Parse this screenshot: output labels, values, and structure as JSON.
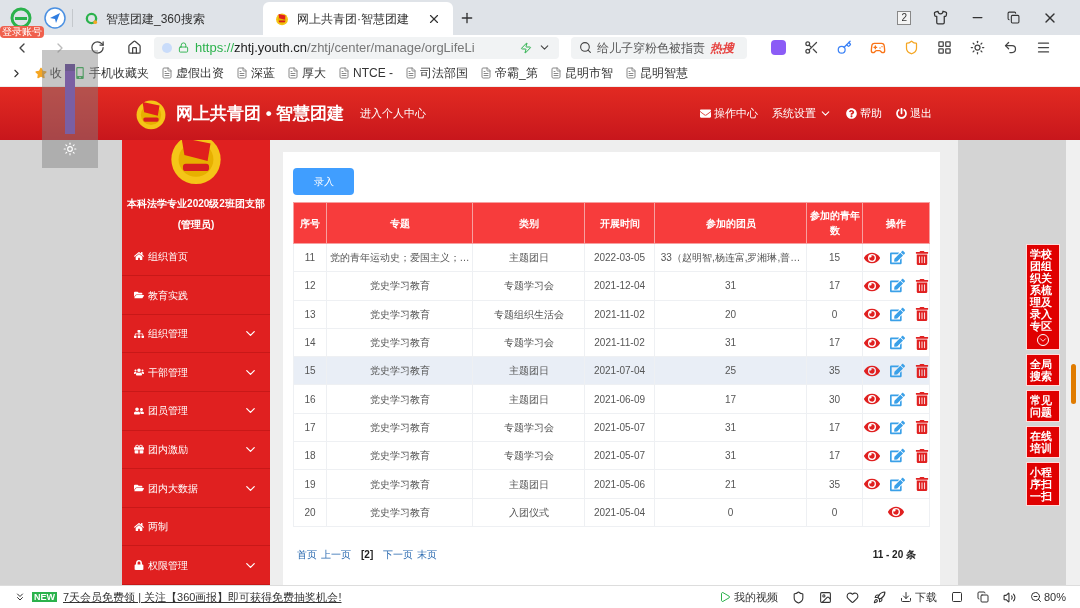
{
  "browser": {
    "login_badge": "登录账号",
    "tabs": [
      {
        "label": "智慧团建_360搜索",
        "selected": false
      },
      {
        "label": "网上共青团·智慧团建",
        "selected": true
      }
    ],
    "tab_count": "2",
    "url": {
      "scheme": "https://",
      "host": "zhtj.youth.cn",
      "path": "/zhtj/center/manage/orgLifeLi"
    },
    "search": {
      "value": "给儿子穿粉色被指责",
      "hot": "热搜"
    },
    "bookmarks": [
      "收",
      "手机收藏夹",
      "虚假出资",
      "深蓝",
      "厚大",
      "NTCE -",
      "司法部国",
      "帝霸_第",
      "昆明市智",
      "昆明智慧"
    ],
    "brightness": {
      "level": 0.9
    }
  },
  "header": {
    "title": "网上共青团 • 智慧团建",
    "personal": "进入个人中心",
    "links": [
      "操作中心",
      "系统设置",
      "帮助",
      "退出"
    ]
  },
  "sidebar": {
    "org_name": "本科法学专业2020级2班团支部",
    "role": "(管理员)",
    "items": [
      {
        "label": "组织首页",
        "expandable": false
      },
      {
        "label": "教育实践",
        "expandable": false
      },
      {
        "label": "组织管理",
        "expandable": true
      },
      {
        "label": "干部管理",
        "expandable": true
      },
      {
        "label": "团员管理",
        "expandable": true
      },
      {
        "label": "团内激励",
        "expandable": true
      },
      {
        "label": "团内大数据",
        "expandable": true
      },
      {
        "label": "两制",
        "expandable": false
      },
      {
        "label": "权限管理",
        "expandable": true
      }
    ]
  },
  "add_button": "录入",
  "table": {
    "columns": [
      "序号",
      "专题",
      "类别",
      "开展时间",
      "参加的团员",
      "参加的青年数",
      "操作"
    ],
    "rows": [
      {
        "cells": [
          "11",
          "党的青年运动史；爱国主义；…",
          "主题团日",
          "2022-03-05",
          "33（赵明智,杨连富,罗湘琳,普…",
          "15"
        ],
        "selected": false,
        "editable": true
      },
      {
        "cells": [
          "12",
          "党史学习教育",
          "专题学习会",
          "2021-12-04",
          "31",
          "17"
        ],
        "selected": false,
        "editable": true
      },
      {
        "cells": [
          "13",
          "党史学习教育",
          "专题组织生活会",
          "2021-11-02",
          "20",
          "0"
        ],
        "selected": false,
        "editable": true
      },
      {
        "cells": [
          "14",
          "党史学习教育",
          "专题学习会",
          "2021-11-02",
          "31",
          "17"
        ],
        "selected": false,
        "editable": true
      },
      {
        "cells": [
          "15",
          "党史学习教育",
          "主题团日",
          "2021-07-04",
          "25",
          "35"
        ],
        "selected": true,
        "editable": true
      },
      {
        "cells": [
          "16",
          "党史学习教育",
          "主题团日",
          "2021-06-09",
          "17",
          "30"
        ],
        "selected": false,
        "editable": true
      },
      {
        "cells": [
          "17",
          "党史学习教育",
          "专题学习会",
          "2021-05-07",
          "31",
          "17"
        ],
        "selected": false,
        "editable": true
      },
      {
        "cells": [
          "18",
          "党史学习教育",
          "专题学习会",
          "2021-05-07",
          "31",
          "17"
        ],
        "selected": false,
        "editable": true
      },
      {
        "cells": [
          "19",
          "党史学习教育",
          "主题团日",
          "2021-05-06",
          "21",
          "35"
        ],
        "selected": false,
        "editable": true
      },
      {
        "cells": [
          "20",
          "党史学习教育",
          "入团仪式",
          "2021-05-04",
          "0",
          "0"
        ],
        "selected": false,
        "editable": false
      }
    ]
  },
  "pager": {
    "links": [
      {
        "label": "首页",
        "selected": false
      },
      {
        "label": "上一页",
        "selected": false
      },
      {
        "label": "[2]",
        "selected": true
      },
      {
        "label": "下一页",
        "selected": false
      },
      {
        "label": "末页",
        "selected": false
      }
    ],
    "summary": "11 - 20 条"
  },
  "float_menu": [
    {
      "label": "学校团组织关系梳理及录入专区",
      "expand": true
    },
    {
      "label": "全局搜索",
      "expand": false
    },
    {
      "label": "常见问题",
      "expand": false
    },
    {
      "label": "在线培训",
      "expand": false
    },
    {
      "label": "小程序扫一扫",
      "expand": false
    }
  ],
  "status_bar": {
    "badge": "NEW",
    "news": "7天会员免费领 | 关注【360画报】即可获得免费抽奖机会!",
    "video": "我的视频",
    "download": "下载",
    "zoom": "80%"
  }
}
